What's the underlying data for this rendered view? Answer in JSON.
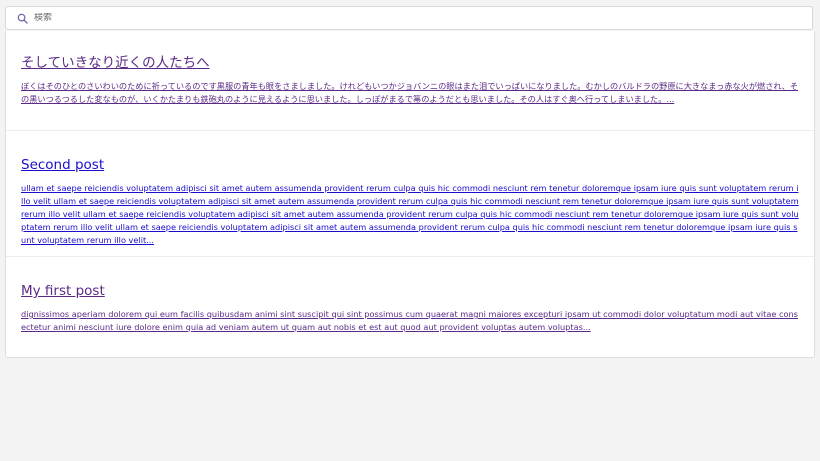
{
  "search": {
    "placeholder": "検索",
    "icon": "search-icon"
  },
  "posts": [
    {
      "title": "そしていきなり近くの人たちへ",
      "excerpt": "ぼくはそのひとのさいわいのために祈っているのです黒服の青年も眼をさましました。けれどもいつかジョバンニの眼はまた泪でいっぱいになりました。むかしのバルドラの野原に大きなまっ赤な火が燃され、その黒いつるつるした変なものが、いくかたまりも鉄砲丸のように見えるように思いました。しっぽがまるで箒のようだとも思いました。その人はすぐ奥へ行ってしまいました。...",
      "visited": true
    },
    {
      "title": "Second post",
      "excerpt": "ullam et saepe reiciendis voluptatem adipisci sit amet autem assumenda provident rerum culpa quis hic commodi nesciunt rem tenetur doloremque ipsam iure quis sunt voluptatem rerum illo velit ullam et saepe reiciendis voluptatem adipisci sit amet autem assumenda provident rerum culpa quis hic commodi nesciunt rem tenetur doloremque ipsam iure quis sunt voluptatem rerum illo velit ullam et saepe reiciendis voluptatem adipisci sit amet autem assumenda provident rerum culpa quis hic commodi nesciunt rem tenetur doloremque ipsam iure quis sunt voluptatem rerum illo velit ullam et saepe reiciendis voluptatem adipisci sit amet autem assumenda provident rerum culpa quis hic commodi nesciunt rem tenetur doloremque ipsam iure quis sunt voluptatem rerum illo velit...",
      "visited": false
    },
    {
      "title": "My first post",
      "excerpt": "dignissimos aperiam dolorem qui eum facilis quibusdam animi sint suscipit qui sint possimus cum quaerat magni maiores excepturi ipsam ut commodi dolor voluptatum modi aut vitae consectetur animi nesciunt iure dolore enim quia ad veniam autem ut quam aut nobis et est aut quod aut provident voluptas autem voluptas...",
      "visited": true
    }
  ],
  "colors": {
    "visited_link": "#5a2a86",
    "unvisited_link": "#1a0dcc",
    "page_background": "#f3f3f3",
    "panel_background": "#ffffff"
  }
}
